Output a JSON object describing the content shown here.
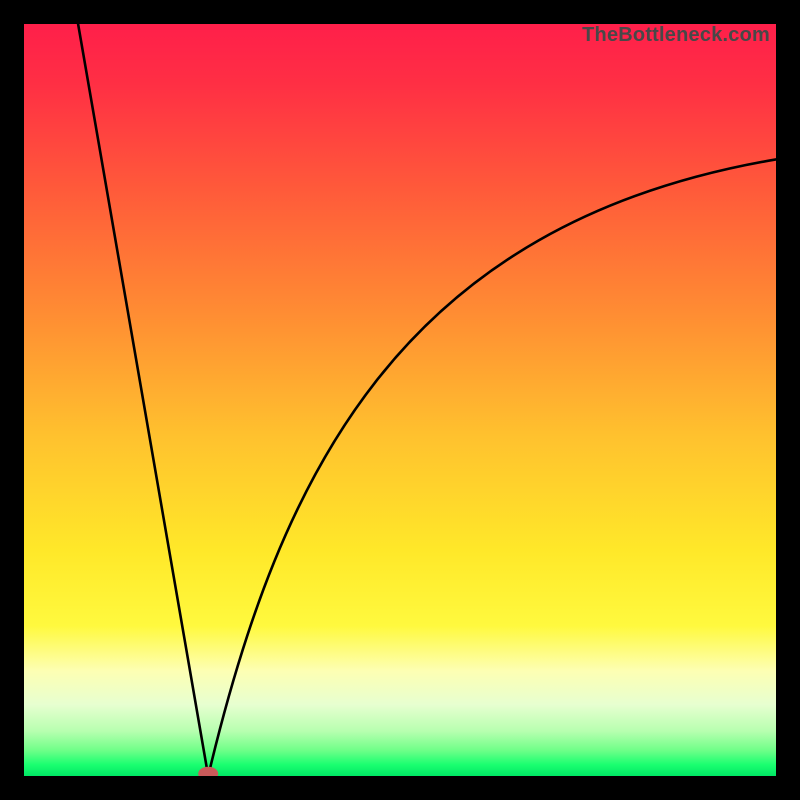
{
  "source_label": "TheBottleneck.com",
  "chart_data": {
    "type": "line",
    "title": "",
    "xlabel": "",
    "ylabel": "",
    "xlim": [
      0,
      1
    ],
    "ylim": [
      0,
      1
    ],
    "grid": false,
    "legend": false,
    "curve": {
      "min_x": 0.245,
      "left_start": {
        "x": 0.072,
        "y_norm": 1.0
      },
      "right_end": {
        "x": 1.0,
        "y_norm": 0.82
      },
      "right_shape": {
        "cx1": 0.34,
        "cy1_norm": 0.4,
        "cx2": 0.5,
        "cy2_norm": 0.735
      }
    },
    "marker": {
      "x": 0.245,
      "y_norm": 0.003,
      "color": "#c95a5a"
    },
    "gradient_stops": [
      {
        "offset": 0.0,
        "color": "#ff1f4a"
      },
      {
        "offset": 0.08,
        "color": "#ff2f44"
      },
      {
        "offset": 0.22,
        "color": "#ff5a3a"
      },
      {
        "offset": 0.38,
        "color": "#ff8b33"
      },
      {
        "offset": 0.55,
        "color": "#ffc22e"
      },
      {
        "offset": 0.7,
        "color": "#ffe829"
      },
      {
        "offset": 0.8,
        "color": "#fff93e"
      },
      {
        "offset": 0.86,
        "color": "#fdffb3"
      },
      {
        "offset": 0.905,
        "color": "#e7ffd0"
      },
      {
        "offset": 0.94,
        "color": "#b8ffb0"
      },
      {
        "offset": 0.965,
        "color": "#72ff8a"
      },
      {
        "offset": 0.985,
        "color": "#1aff70"
      },
      {
        "offset": 1.0,
        "color": "#00e765"
      }
    ]
  }
}
